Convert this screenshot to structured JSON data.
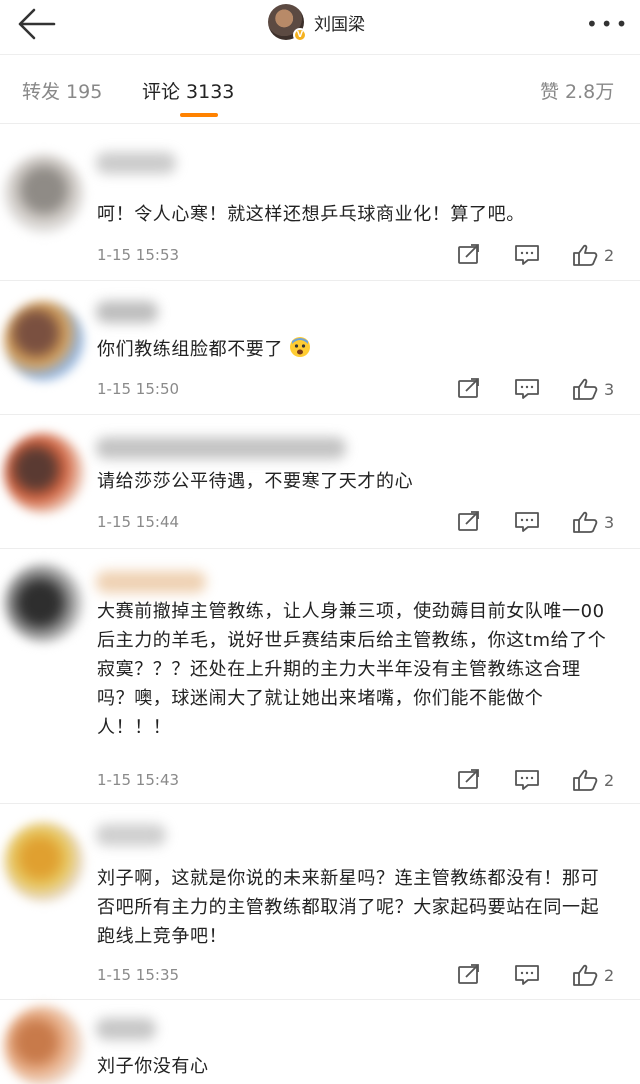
{
  "header": {
    "username": "刘国梁",
    "verified_badge": "V",
    "more_icon": "more-icon",
    "back_icon": "back-arrow-icon"
  },
  "tabs": [
    {
      "label": "转发 195",
      "active": false
    },
    {
      "label": "评论 3133",
      "active": true
    },
    {
      "label": "赞 2.8万",
      "active": false
    }
  ],
  "accent_color": "#ff8200",
  "comments": [
    {
      "text": "呵！令人心寒！就这样还想乒乓球商业化！算了吧。",
      "time": "1-15 15:53",
      "likes": "2"
    },
    {
      "text": "你们教练组脸都不要了",
      "emoji": "fearful-face-icon",
      "time": "1-15 15:50",
      "likes": "3"
    },
    {
      "text": "请给莎莎公平待遇，不要寒了天才的心",
      "time": "1-15 15:44",
      "likes": "3"
    },
    {
      "text": "大赛前撤掉主管教练，让人身兼三项，使劲薅目前女队唯一00后主力的羊毛，说好世乒赛结束后给主管教练，你这tm给了个寂寞？？？还处在上升期的主力大半年没有主管教练这合理吗？噢，球迷闹大了就让她出来堵嘴，你们能不能做个人！！！",
      "time": "1-15 15:43",
      "likes": "2"
    },
    {
      "text": "刘子啊，这就是你说的未来新星吗？连主管教练都没有！那可否吧所有主力的主管教练都取消了呢？大家起码要站在同一起跑线上竞争吧！",
      "time": "1-15 15:35",
      "likes": "2"
    },
    {
      "text": "刘子你没有心",
      "time": "",
      "likes": ""
    }
  ]
}
